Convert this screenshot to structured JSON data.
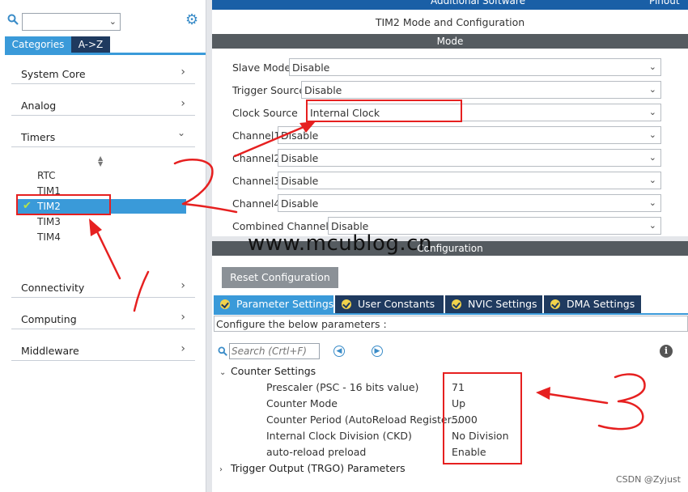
{
  "top_strip": {
    "left_text": "Additional Software",
    "right_text": "Pinout"
  },
  "left_panel": {
    "categories_tab": "Categories",
    "az_tab": "A->Z",
    "combo_value": "",
    "items": [
      {
        "label": "System Core"
      },
      {
        "label": "Analog"
      },
      {
        "label": "Timers"
      },
      {
        "label": "Connectivity"
      },
      {
        "label": "Computing"
      },
      {
        "label": "Middleware"
      }
    ],
    "timers": [
      "RTC",
      "TIM1",
      "TIM2",
      "TIM3",
      "TIM4"
    ],
    "selected_timer": "TIM2",
    "icons": {
      "search": "search-icon",
      "gear": "gear-icon",
      "chevron": "chevron-right-icon",
      "check": "check-icon"
    }
  },
  "right_panel": {
    "title": "TIM2 Mode and Configuration",
    "mode_header": "Mode",
    "mode_rows": [
      {
        "label": "Slave Mode",
        "value": "Disable"
      },
      {
        "label": "Trigger Source",
        "value": "Disable"
      },
      {
        "label": "Clock Source",
        "value": "Internal Clock"
      },
      {
        "label": "Channel1",
        "value": "Disable"
      },
      {
        "label": "Channel2",
        "value": "Disable"
      },
      {
        "label": "Channel3",
        "value": "Disable"
      },
      {
        "label": "Channel4",
        "value": "Disable"
      },
      {
        "label": "Combined Channels",
        "value": "Disable"
      }
    ],
    "config_header": "Configuration",
    "reset_button": "Reset Configuration",
    "tabs": [
      "Parameter Settings",
      "User Constants",
      "NVIC Settings",
      "DMA Settings"
    ],
    "active_tab": "Parameter Settings",
    "description": "Configure the below parameters :",
    "search_placeholder": "Search (Crtl+F)",
    "counter_settings": "Counter Settings",
    "params": [
      {
        "label": "Prescaler (PSC - 16 bits value)",
        "value": "71"
      },
      {
        "label": "Counter Mode",
        "value": "Up"
      },
      {
        "label": "Counter Period (AutoReload Register...",
        "value": "5000"
      },
      {
        "label": "Internal Clock Division (CKD)",
        "value": "No Division"
      },
      {
        "label": "auto-reload preload",
        "value": "Enable"
      }
    ],
    "trigger_output": "Trigger Output (TRGO) Parameters"
  },
  "watermark": "www.mcublog.cn",
  "credit": "CSDN @Zyjust",
  "colors": {
    "accent": "#3a9ad9",
    "dark_tab": "#1f3a5f",
    "header": "#555b60",
    "annotation": "#e62020"
  }
}
